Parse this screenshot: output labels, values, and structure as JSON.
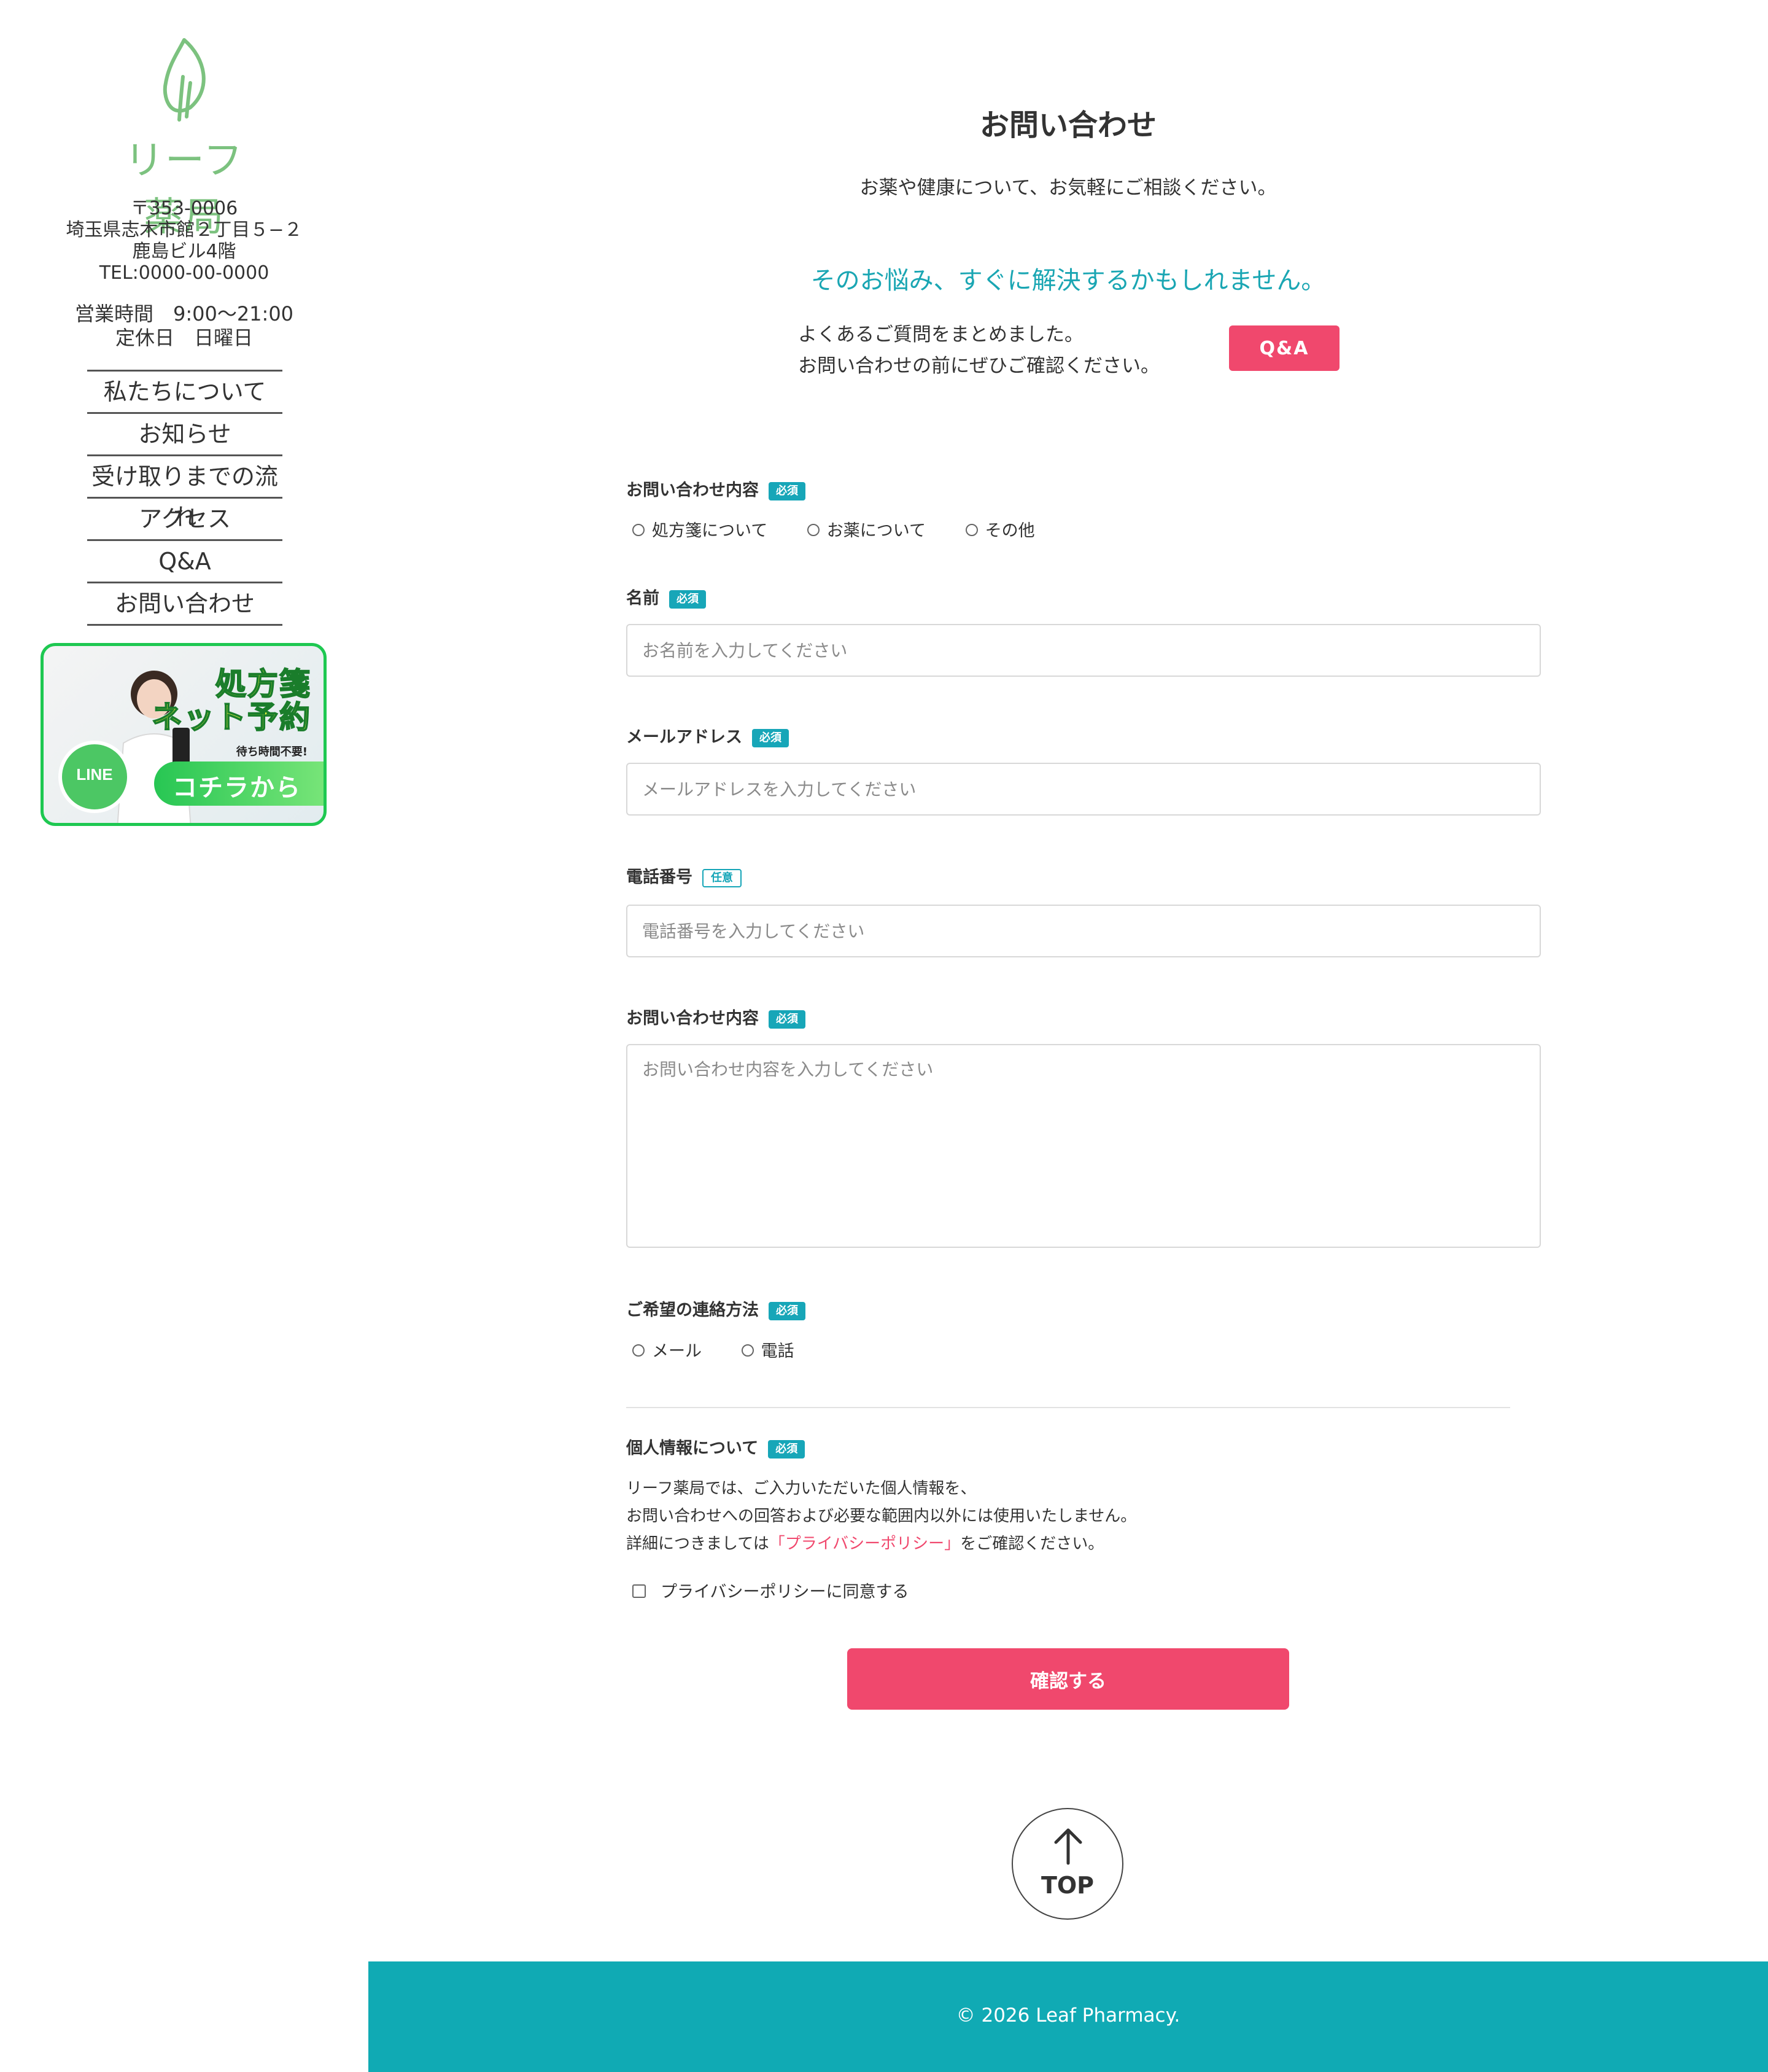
{
  "brand": {
    "name": "リーフ薬局",
    "leaf_color": "#7cc27f"
  },
  "address": {
    "zip": "〒353-0006",
    "line1": "埼玉県志木市館２丁目５−２",
    "line2": "鹿島ビル4階",
    "tel": "TEL:0000-00-0000"
  },
  "hours": {
    "open": "営業時間　9:00〜21:00",
    "closed": "定休日　日曜日"
  },
  "nav": [
    {
      "label": "私たちについて"
    },
    {
      "label": "お知らせ"
    },
    {
      "label": "受け取りまでの流れ"
    },
    {
      "label": "アクセス"
    },
    {
      "label": "Q&A"
    },
    {
      "label": "お問い合わせ"
    }
  ],
  "banner": {
    "title1": "処方箋",
    "title2": "ネット予約",
    "subtitle": "待ち時間不要!",
    "line_label": "LINE",
    "cta": "コチラから",
    "border_color": "#1ec851"
  },
  "page": {
    "title": "お問い合わせ",
    "lead": "お薬や健康について、お気軽にご相談ください。"
  },
  "faq": {
    "heading": "そのお悩み、すぐに解決するかもしれません。",
    "line1": "よくあるご質問をまとめました。",
    "line2": "お問い合わせの前にぜひご確認ください。",
    "button": "Q&A"
  },
  "form": {
    "required_badge": "必須",
    "optional_badge": "任意",
    "inquiry_type": {
      "label": "お問い合わせ内容",
      "options": [
        "処方箋について",
        "お薬について",
        "その他"
      ]
    },
    "name": {
      "label": "名前",
      "placeholder": "お名前を入力してください"
    },
    "email": {
      "label": "メールアドレス",
      "placeholder": "メールアドレスを入力してください"
    },
    "phone": {
      "label": "電話番号",
      "placeholder": "電話番号を入力してください"
    },
    "message": {
      "label": "お問い合わせ内容",
      "placeholder": "お問い合わせ内容を入力してください"
    },
    "contact_method": {
      "label": "ご希望の連絡方法",
      "options": [
        "メール",
        "電話"
      ]
    },
    "privacy": {
      "label": "個人情報について",
      "line1": "リーフ薬局では、ご入力いただいた個人情報を、",
      "line2": "お問い合わせへの回答および必要な範囲内以外には使用いたしません。",
      "line3_prefix": "詳細につきましては",
      "line3_link": "「プライバシーポリシー」",
      "line3_suffix": "をご確認ください。",
      "agree": "プライバシーポリシーに同意する"
    },
    "submit": "確認する"
  },
  "top_button": {
    "label": "TOP"
  },
  "footer": {
    "copyright": "© 2026 Leaf Pharmacy."
  },
  "colors": {
    "accent": "#f0486d",
    "teal": "#10aab4",
    "badge": "#17a6b8"
  }
}
